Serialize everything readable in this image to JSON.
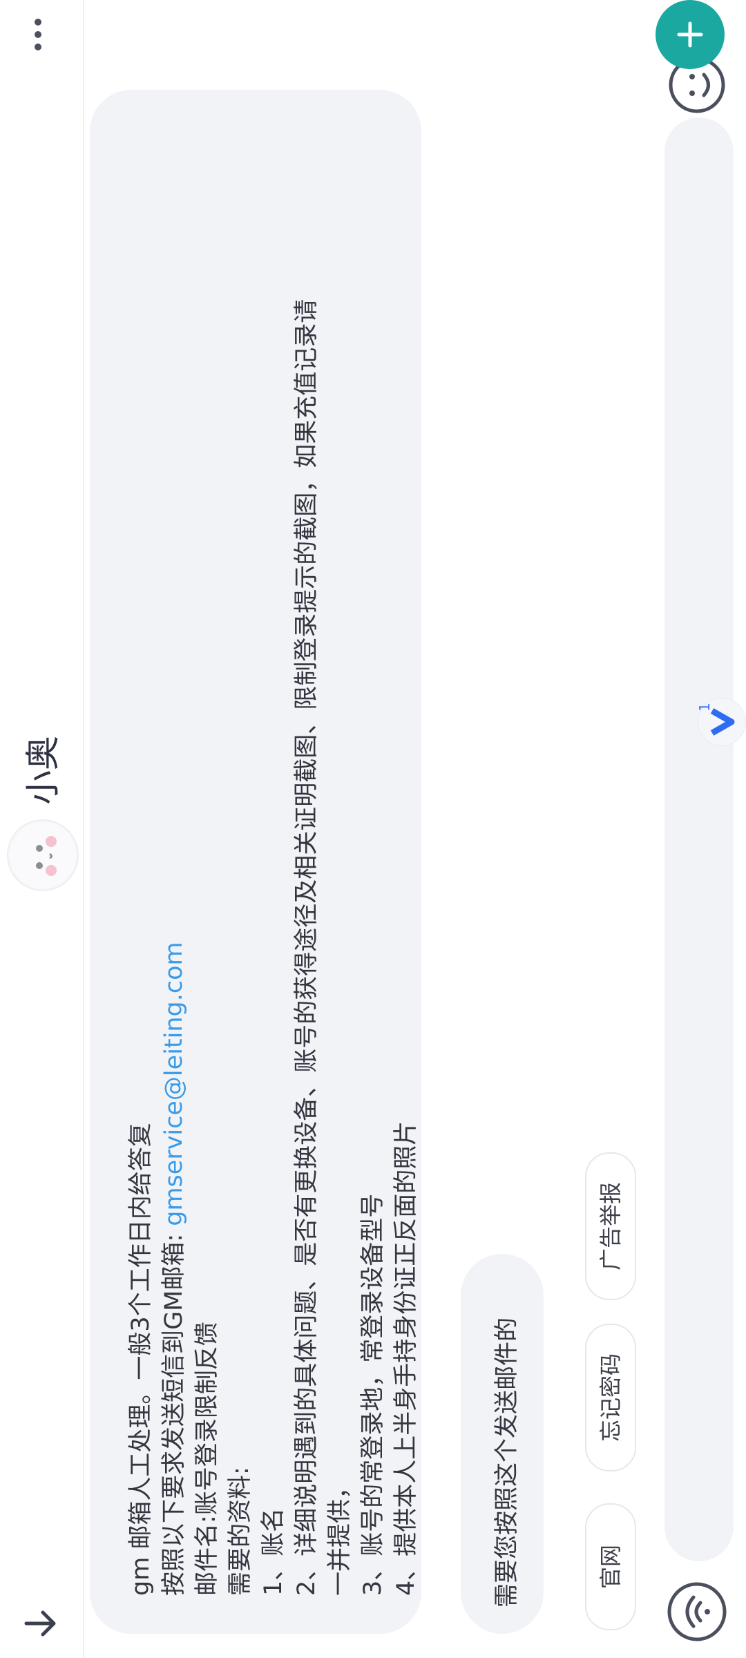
{
  "header": {
    "title": "小奥",
    "avatar_icon": "avatar-icon",
    "back_icon": "arrow-down-icon",
    "more_icon": "more-vertical-icon"
  },
  "chat": {
    "bot_message_lines": [
      "gm 邮箱人工处理。一般3个工作日内给答复",
      "按照以下要求发送短信到GM邮箱: ",
      "gmservice@leiting.com",
      "邮件名:账号登录限制反馈",
      "需要的资料:",
      "1、账名",
      "2、详细说明遇到的具体问题、是否有更换设备、账号的获得途径及相关证明截图、限制登录提示的截图，如果充值记录请",
      "一并提供，",
      "3、账号的常登录地，常登录设备型号",
      "4、提供本人上半身手持身份证正反面的照片"
    ],
    "user_message": "需要您按照这个发送邮件的",
    "quick_actions": [
      "官网",
      "忘记密码",
      "广告举报"
    ]
  },
  "input_bar": {
    "wifi_icon": "wifi-icon",
    "emoji_icon": "smiley-icon",
    "plus_icon": "plus-icon",
    "badge_count": "1"
  },
  "colors": {
    "accent": "#1aa8a0",
    "link": "#3a9be8",
    "bubble": "#f1f3f7",
    "text": "#33363f"
  }
}
